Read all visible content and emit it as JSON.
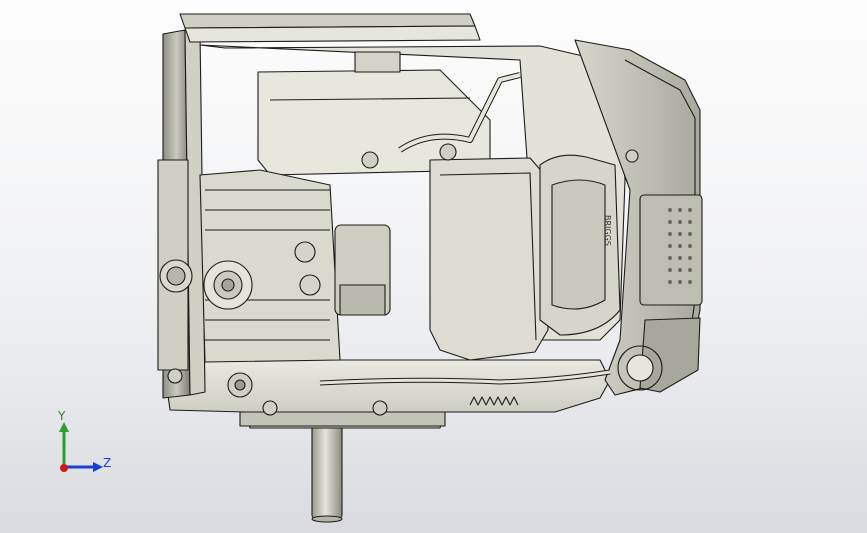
{
  "viewport": {
    "background_top": "#fdfdfd",
    "background_bottom": "#d9dbe0"
  },
  "model": {
    "kind": "engine-assembly",
    "brand_text": "BRIGGS",
    "line_color": "#1c1c1c",
    "body_color": "#dcdcd2"
  },
  "triad": {
    "y_label": "Y",
    "z_label": "Z",
    "y_color": "#2e9e2e",
    "z_color": "#1a3fd0",
    "x_color": "#d01a1a"
  }
}
